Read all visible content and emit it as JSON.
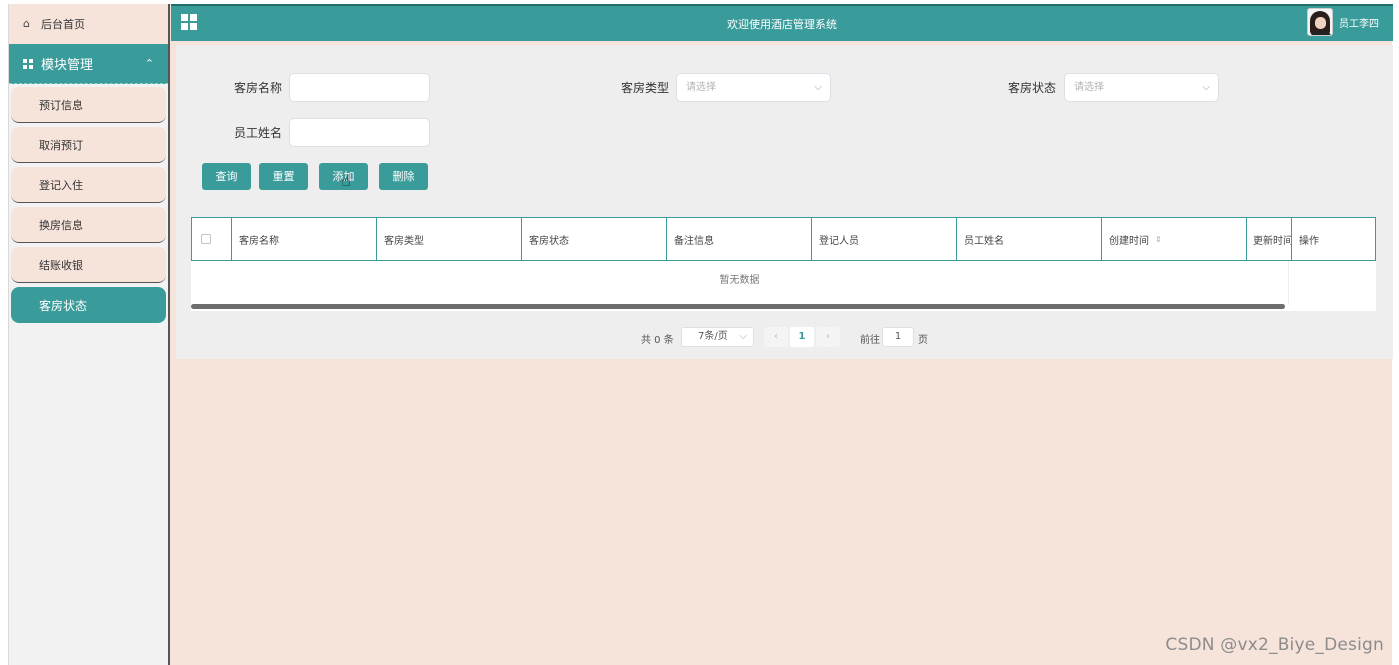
{
  "sidebar": {
    "home_label": "后台首页",
    "module_label": "模块管理",
    "items": [
      {
        "label": "预订信息"
      },
      {
        "label": "取消预订"
      },
      {
        "label": "登记入住"
      },
      {
        "label": "换房信息"
      },
      {
        "label": "结账收银"
      },
      {
        "label": "客房状态",
        "active": true
      }
    ]
  },
  "header": {
    "title": "欢迎使用酒店管理系统",
    "user_name": "员工李四"
  },
  "filters": {
    "room_name_label": "客房名称",
    "room_type_label": "客房类型",
    "room_type_placeholder": "请选择",
    "room_status_label": "客房状态",
    "room_status_placeholder": "请选择",
    "employee_name_label": "员工姓名"
  },
  "actions": {
    "query": "查询",
    "reset": "重置",
    "add": "添加",
    "delete": "删除"
  },
  "table": {
    "columns": [
      "客房名称",
      "客房类型",
      "客房状态",
      "备注信息",
      "登记人员",
      "员工姓名",
      "创建时间",
      "更新时间",
      "操作"
    ],
    "empty_text": "暂无数据"
  },
  "pagination": {
    "total_text": "共 0 条",
    "page_size": "7条/页",
    "current_page": "1",
    "goto_label": "前往",
    "goto_value": "1",
    "page_suffix": "页"
  },
  "watermark": "CSDN @vx2_Biye_Design",
  "colors": {
    "accent": "#3a9c9a",
    "background": "#f6e3da",
    "panel": "#eeeeef"
  }
}
